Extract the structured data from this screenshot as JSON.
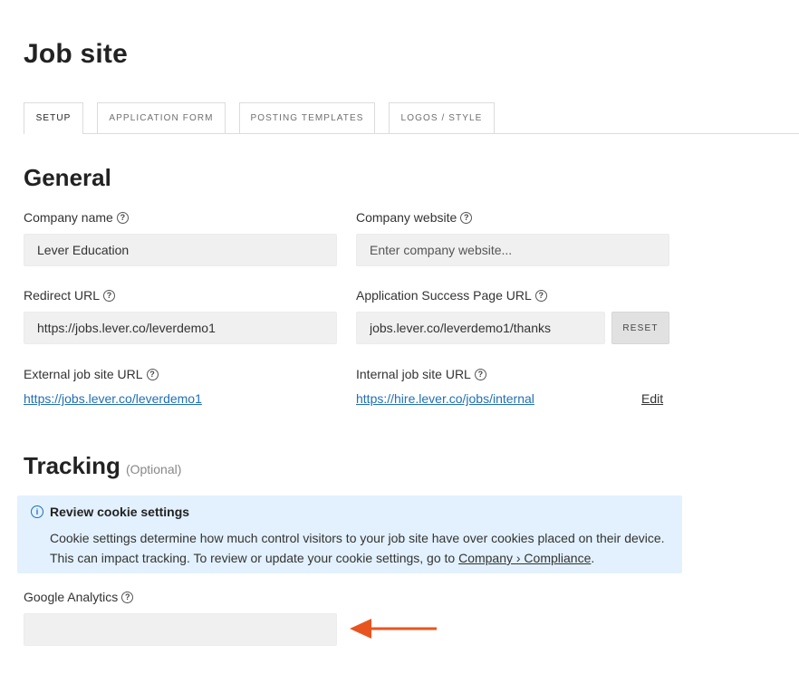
{
  "page": {
    "title": "Job site"
  },
  "tabs": [
    {
      "label": "SETUP",
      "active": true
    },
    {
      "label": "APPLICATION FORM",
      "active": false
    },
    {
      "label": "POSTING TEMPLATES",
      "active": false
    },
    {
      "label": "LOGOS / STYLE",
      "active": false
    }
  ],
  "general": {
    "heading": "General",
    "company_name": {
      "label": "Company name",
      "value": "Lever Education"
    },
    "company_website": {
      "label": "Company website",
      "placeholder": "Enter company website..."
    },
    "redirect_url": {
      "label": "Redirect URL",
      "value": "https://jobs.lever.co/leverdemo1"
    },
    "success_page_url": {
      "label": "Application Success Page URL",
      "value": "jobs.lever.co/leverdemo1/thanks",
      "reset_label": "RESET"
    },
    "external_site": {
      "label": "External job site URL",
      "link": "https://jobs.lever.co/leverdemo1"
    },
    "internal_site": {
      "label": "Internal job site URL",
      "link": "https://hire.lever.co/jobs/internal",
      "edit_label": "Edit"
    }
  },
  "tracking": {
    "heading": "Tracking",
    "optional": "(Optional)",
    "banner": {
      "title": "Review cookie settings",
      "line1": "Cookie settings determine how much control visitors to your job site have over cookies placed on their device.",
      "line2_prefix": "This can impact tracking. To review or update your cookie settings, go to",
      "line2_link": "Company › Compliance",
      "line2_suffix": "."
    },
    "google_analytics": {
      "label": "Google Analytics",
      "value": ""
    }
  },
  "colors": {
    "accent_link": "#1f6fb8",
    "banner_bg": "#e2f1fd",
    "arrow": "#e8541f"
  },
  "icons": {
    "help": "question-circle-icon",
    "info": "info-circle-icon",
    "arrow": "arrow-left-icon"
  }
}
